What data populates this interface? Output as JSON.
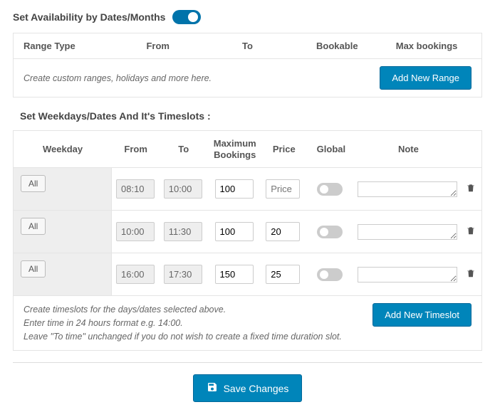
{
  "availability": {
    "title": "Set Availability by Dates/Months",
    "enabled": true
  },
  "rangeTable": {
    "headers": [
      "Range Type",
      "From",
      "To",
      "Bookable",
      "Max bookings"
    ],
    "hint": "Create custom ranges, holidays and more here.",
    "add_label": "Add New Range"
  },
  "timeslotSection": {
    "title": "Set Weekdays/Dates And It's Timeslots :",
    "headers": {
      "weekday": "Weekday",
      "from": "From",
      "to": "To",
      "max_bookings": "Maximum Bookings",
      "price": "Price",
      "global": "Global",
      "note": "Note"
    },
    "all_label": "All",
    "rows": [
      {
        "from": "08:10",
        "to": "10:00",
        "max": "100",
        "price": "",
        "price_placeholder": "Price",
        "global": false,
        "note": ""
      },
      {
        "from": "10:00",
        "to": "11:30",
        "max": "100",
        "price": "20",
        "price_placeholder": "Price",
        "global": false,
        "note": ""
      },
      {
        "from": "16:00",
        "to": "17:30",
        "max": "150",
        "price": "25",
        "price_placeholder": "Price",
        "global": false,
        "note": ""
      }
    ],
    "hints": [
      "Create timeslots for the days/dates selected above.",
      "Enter time in 24 hours format e.g. 14:00.",
      "Leave \"To time\" unchanged if you do not wish to create a fixed time duration slot."
    ],
    "add_label": "Add New Timeslot"
  },
  "save_label": "Save Changes"
}
